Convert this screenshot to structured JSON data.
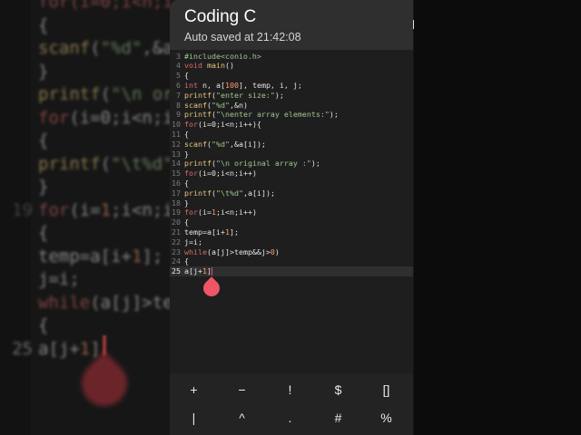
{
  "app": {
    "title": "Coding C",
    "status": "Auto saved at 21:42:08"
  },
  "editor": {
    "current_line": 25,
    "lines": [
      {
        "n": "3",
        "tokens": [
          {
            "t": "#include<conio.h>",
            "c": "str"
          }
        ]
      },
      {
        "n": "4",
        "tokens": [
          {
            "t": "void ",
            "c": "kw"
          },
          {
            "t": "main",
            "c": "id"
          },
          {
            "t": "()",
            "c": "pl"
          }
        ]
      },
      {
        "n": "5",
        "tokens": [
          {
            "t": "{",
            "c": "pl"
          }
        ]
      },
      {
        "n": "6",
        "tokens": [
          {
            "t": "int ",
            "c": "kw"
          },
          {
            "t": "n, a[",
            "c": "pl"
          },
          {
            "t": "100",
            "c": "ty"
          },
          {
            "t": "], temp, i, j;",
            "c": "pl"
          }
        ]
      },
      {
        "n": "7",
        "tokens": [
          {
            "t": "printf",
            "c": "id"
          },
          {
            "t": "(",
            "c": "pl"
          },
          {
            "t": "\"enter size:\"",
            "c": "str"
          },
          {
            "t": ");",
            "c": "pl"
          }
        ]
      },
      {
        "n": "8",
        "tokens": [
          {
            "t": "scanf",
            "c": "id"
          },
          {
            "t": "(",
            "c": "pl"
          },
          {
            "t": "\"%d\"",
            "c": "str"
          },
          {
            "t": ",&n)",
            "c": "pl"
          }
        ]
      },
      {
        "n": "9",
        "tokens": [
          {
            "t": "printf",
            "c": "id"
          },
          {
            "t": "(",
            "c": "pl"
          },
          {
            "t": "\"\\nenter array elements:\"",
            "c": "str"
          },
          {
            "t": ");",
            "c": "pl"
          }
        ]
      },
      {
        "n": "10",
        "tokens": [
          {
            "t": "for",
            "c": "kw"
          },
          {
            "t": "(i=0;i<n;i++){",
            "c": "pl"
          }
        ]
      },
      {
        "n": "11",
        "tokens": [
          {
            "t": "{",
            "c": "pl"
          }
        ]
      },
      {
        "n": "12",
        "tokens": [
          {
            "t": "scanf",
            "c": "id"
          },
          {
            "t": "(",
            "c": "pl"
          },
          {
            "t": "\"%d\"",
            "c": "str"
          },
          {
            "t": ",&a[i]);",
            "c": "pl"
          }
        ]
      },
      {
        "n": "13",
        "tokens": [
          {
            "t": "}",
            "c": "pl"
          }
        ]
      },
      {
        "n": "14",
        "tokens": [
          {
            "t": "printf",
            "c": "id"
          },
          {
            "t": "(",
            "c": "pl"
          },
          {
            "t": "\"\\n original array :\"",
            "c": "str"
          },
          {
            "t": ");",
            "c": "pl"
          }
        ]
      },
      {
        "n": "15",
        "tokens": [
          {
            "t": "for",
            "c": "kw"
          },
          {
            "t": "(i=0;i<n;i++)",
            "c": "pl"
          }
        ]
      },
      {
        "n": "16",
        "tokens": [
          {
            "t": "{",
            "c": "pl"
          }
        ]
      },
      {
        "n": "17",
        "tokens": [
          {
            "t": "printf",
            "c": "id"
          },
          {
            "t": "(",
            "c": "pl"
          },
          {
            "t": "\"\\t%d\"",
            "c": "str"
          },
          {
            "t": ",a[i]);",
            "c": "pl"
          }
        ]
      },
      {
        "n": "18",
        "tokens": [
          {
            "t": "}",
            "c": "pl"
          }
        ]
      },
      {
        "n": "19",
        "tokens": [
          {
            "t": "for",
            "c": "kw"
          },
          {
            "t": "(i=",
            "c": "pl"
          },
          {
            "t": "1",
            "c": "ty"
          },
          {
            "t": ";i<n;i++)",
            "c": "pl"
          }
        ]
      },
      {
        "n": "20",
        "tokens": [
          {
            "t": "{",
            "c": "pl"
          }
        ]
      },
      {
        "n": "21",
        "tokens": [
          {
            "t": "temp=a[i+",
            "c": "pl"
          },
          {
            "t": "1",
            "c": "ty"
          },
          {
            "t": "];",
            "c": "pl"
          }
        ]
      },
      {
        "n": "22",
        "tokens": [
          {
            "t": "j=i;",
            "c": "pl"
          }
        ]
      },
      {
        "n": "23",
        "tokens": [
          {
            "t": "while",
            "c": "kw"
          },
          {
            "t": "(a[j]>temp&&j>",
            "c": "pl"
          },
          {
            "t": "0",
            "c": "ty"
          },
          {
            "t": ")",
            "c": "pl"
          }
        ]
      },
      {
        "n": "24",
        "tokens": [
          {
            "t": "{",
            "c": "pl"
          }
        ]
      },
      {
        "n": "25",
        "tokens": [
          {
            "t": "a[j+",
            "c": "pl"
          },
          {
            "t": "1",
            "c": "ty"
          },
          {
            "t": "]",
            "c": "pl"
          }
        ]
      }
    ]
  },
  "background_zoom": {
    "lines": [
      {
        "n": "",
        "tokens": [
          {
            "t": "for(i=0;i<n;i++)",
            "c": "kw"
          }
        ]
      },
      {
        "n": "",
        "tokens": [
          {
            "t": "{",
            "c": "pl"
          }
        ]
      },
      {
        "n": "",
        "tokens": [
          {
            "t": "scanf",
            "c": "id"
          },
          {
            "t": "(",
            "c": "pl"
          },
          {
            "t": "\"%d\"",
            "c": "str"
          },
          {
            "t": ",&a[i]);",
            "c": "pl"
          }
        ]
      },
      {
        "n": "",
        "tokens": [
          {
            "t": "}",
            "c": "pl"
          }
        ]
      },
      {
        "n": "",
        "tokens": [
          {
            "t": "printf",
            "c": "id"
          },
          {
            "t": "(",
            "c": "pl"
          },
          {
            "t": "\"\\n original array :\"",
            "c": "str"
          },
          {
            "t": ");",
            "c": "pl"
          }
        ]
      },
      {
        "n": "",
        "tokens": [
          {
            "t": "for",
            "c": "kw"
          },
          {
            "t": "(i=0;i<n;i++)",
            "c": "pl"
          }
        ]
      },
      {
        "n": "",
        "tokens": [
          {
            "t": "{",
            "c": "pl"
          }
        ]
      },
      {
        "n": "",
        "tokens": [
          {
            "t": "printf",
            "c": "id"
          },
          {
            "t": "(",
            "c": "pl"
          },
          {
            "t": "\"\\t%d\"",
            "c": "str"
          },
          {
            "t": ",a[i]);",
            "c": "pl"
          }
        ]
      },
      {
        "n": "",
        "tokens": [
          {
            "t": "}",
            "c": "pl"
          }
        ]
      },
      {
        "n": "19",
        "tokens": [
          {
            "t": "for",
            "c": "kw"
          },
          {
            "t": "(i=",
            "c": "pl"
          },
          {
            "t": "1",
            "c": "ty"
          },
          {
            "t": ";i<n;i++)",
            "c": "pl"
          }
        ]
      },
      {
        "n": "",
        "tokens": [
          {
            "t": "{",
            "c": "pl"
          }
        ]
      },
      {
        "n": "",
        "tokens": [
          {
            "t": "temp=a[i+",
            "c": "pl"
          },
          {
            "t": "1",
            "c": "ty"
          },
          {
            "t": "];",
            "c": "pl"
          }
        ]
      },
      {
        "n": "",
        "tokens": [
          {
            "t": "j=i;",
            "c": "pl"
          }
        ]
      },
      {
        "n": "",
        "tokens": [
          {
            "t": "while",
            "c": "kw"
          },
          {
            "t": "(a[j]>temp&&j>",
            "c": "pl"
          },
          {
            "t": "0",
            "c": "ty"
          },
          {
            "t": ")",
            "c": "pl"
          }
        ]
      },
      {
        "n": "",
        "tokens": [
          {
            "t": "{",
            "c": "pl"
          }
        ]
      },
      {
        "n": "25",
        "tokens": [
          {
            "t": "a[j+",
            "c": "pl"
          },
          {
            "t": "1",
            "c": "ty"
          },
          {
            "t": "]",
            "c": "pl"
          }
        ]
      }
    ]
  },
  "keys": {
    "row1": [
      "+",
      "−",
      "!",
      "$",
      "[]"
    ],
    "row2": [
      "|",
      "^",
      ".",
      "#",
      "%"
    ]
  },
  "colors": {
    "accent": "#ee5566",
    "keyword": "#d66a6a",
    "identifier": "#e6c67a",
    "string": "#9fc690",
    "number": "#ff9d6c"
  }
}
